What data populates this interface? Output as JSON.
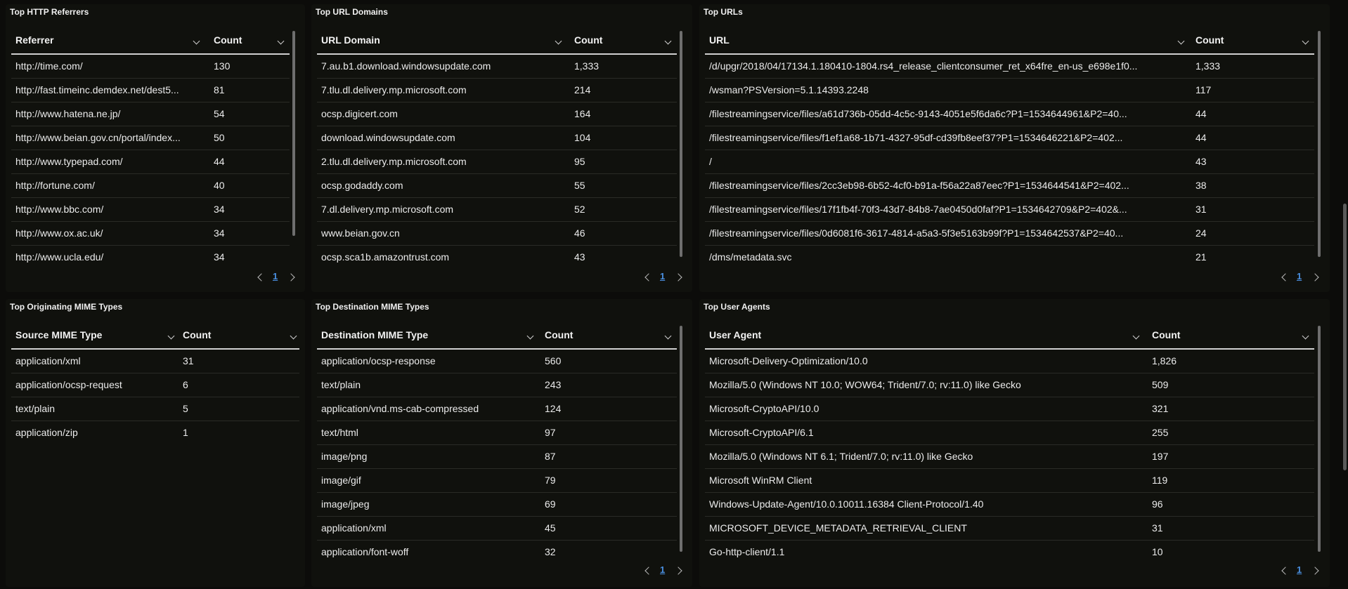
{
  "panels": {
    "referrers": {
      "title": "Top HTTP Referrers",
      "col1": "Referrer",
      "col2": "Count",
      "rows": [
        [
          "http://time.com/",
          "130"
        ],
        [
          "http://fast.timeinc.demdex.net/dest5...",
          "81"
        ],
        [
          "http://www.hatena.ne.jp/",
          "54"
        ],
        [
          "http://www.beian.gov.cn/portal/index...",
          "50"
        ],
        [
          "http://www.typepad.com/",
          "44"
        ],
        [
          "http://fortune.com/",
          "40"
        ],
        [
          "http://www.bbc.com/",
          "34"
        ],
        [
          "http://www.ox.ac.uk/",
          "34"
        ],
        [
          "http://www.ucla.edu/",
          "34"
        ]
      ],
      "page": "1"
    },
    "url_domains": {
      "title": "Top URL Domains",
      "col1": "URL Domain",
      "col2": "Count",
      "rows": [
        [
          "7.au.b1.download.windowsupdate.com",
          "1,333"
        ],
        [
          "7.tlu.dl.delivery.mp.microsoft.com",
          "214"
        ],
        [
          "ocsp.digicert.com",
          "164"
        ],
        [
          "download.windowsupdate.com",
          "104"
        ],
        [
          "2.tlu.dl.delivery.mp.microsoft.com",
          "95"
        ],
        [
          "ocsp.godaddy.com",
          "55"
        ],
        [
          "7.dl.delivery.mp.microsoft.com",
          "52"
        ],
        [
          "www.beian.gov.cn",
          "46"
        ],
        [
          "ocsp.sca1b.amazontrust.com",
          "43"
        ]
      ],
      "page": "1"
    },
    "urls": {
      "title": "Top URLs",
      "col1": "URL",
      "col2": "Count",
      "rows": [
        [
          "/d/upgr/2018/04/17134.1.180410-1804.rs4_release_clientconsumer_ret_x64fre_en-us_e698e1f0...",
          "1,333"
        ],
        [
          "/wsman?PSVersion=5.1.14393.2248",
          "117"
        ],
        [
          "/filestreamingservice/files/a61d736b-05dd-4c5c-9143-4051e5f6da6c?P1=1534644961&P2=40...",
          "44"
        ],
        [
          "/filestreamingservice/files/f1ef1a68-1b71-4327-95df-cd39fb8eef37?P1=1534646221&P2=402...",
          "44"
        ],
        [
          "/",
          "43"
        ],
        [
          "/filestreamingservice/files/2cc3eb98-6b52-4cf0-b91a-f56a22a87eec?P1=1534644541&P2=402...",
          "38"
        ],
        [
          "/filestreamingservice/files/17f1fb4f-70f3-43d7-84b8-7ae0450d0faf?P1=1534642709&P2=402&...",
          "31"
        ],
        [
          "/filestreamingservice/files/0d6081f6-3617-4814-a5a3-5f3e5163b99f?P1=1534642537&P2=40...",
          "24"
        ],
        [
          "/dms/metadata.svc",
          "21"
        ]
      ],
      "page": "1"
    },
    "src_mime": {
      "title": "Top Originating MIME Types",
      "col1": "Source MIME Type",
      "col2": "Count",
      "rows": [
        [
          "application/xml",
          "31"
        ],
        [
          "application/ocsp-request",
          "6"
        ],
        [
          "text/plain",
          "5"
        ],
        [
          "application/zip",
          "1"
        ]
      ]
    },
    "dst_mime": {
      "title": "Top Destination MIME Types",
      "col1": "Destination MIME Type",
      "col2": "Count",
      "rows": [
        [
          "application/ocsp-response",
          "560"
        ],
        [
          "text/plain",
          "243"
        ],
        [
          "application/vnd.ms-cab-compressed",
          "124"
        ],
        [
          "text/html",
          "97"
        ],
        [
          "image/png",
          "87"
        ],
        [
          "image/gif",
          "79"
        ],
        [
          "image/jpeg",
          "69"
        ],
        [
          "application/xml",
          "45"
        ],
        [
          "application/font-woff",
          "32"
        ]
      ],
      "page": "1"
    },
    "user_agents": {
      "title": "Top User Agents",
      "col1": "User Agent",
      "col2": "Count",
      "rows": [
        [
          "Microsoft-Delivery-Optimization/10.0",
          "1,826"
        ],
        [
          "Mozilla/5.0 (Windows NT 10.0; WOW64; Trident/7.0; rv:11.0) like Gecko",
          "509"
        ],
        [
          "Microsoft-CryptoAPI/10.0",
          "321"
        ],
        [
          "Microsoft-CryptoAPI/6.1",
          "255"
        ],
        [
          "Mozilla/5.0 (Windows NT 6.1; Trident/7.0; rv:11.0) like Gecko",
          "197"
        ],
        [
          "Microsoft WinRM Client",
          "119"
        ],
        [
          "Windows-Update-Agent/10.0.10011.16384 Client-Protocol/1.40",
          "96"
        ],
        [
          "MICROSOFT_DEVICE_METADATA_RETRIEVAL_CLIENT",
          "31"
        ],
        [
          "Go-http-client/1.1",
          "10"
        ]
      ],
      "page": "1"
    }
  }
}
